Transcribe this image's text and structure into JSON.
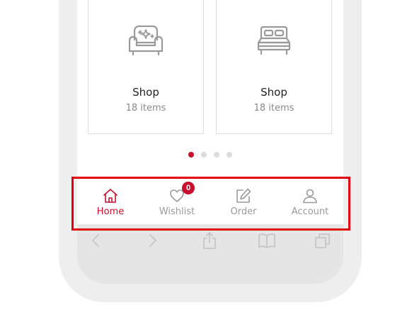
{
  "cards": [
    {
      "title": "Shop",
      "count": "18 items",
      "icon": "armchair-icon"
    },
    {
      "title": "Shop",
      "count": "18 items",
      "icon": "bed-icon"
    }
  ],
  "carousel": {
    "total_pages": 4,
    "active_page": 1
  },
  "nav": {
    "items": [
      {
        "label": "Home",
        "icon": "home-icon",
        "active": true
      },
      {
        "label": "Wishlist",
        "icon": "heart-icon",
        "badge": "0"
      },
      {
        "label": "Order",
        "icon": "edit-icon"
      },
      {
        "label": "Account",
        "icon": "user-icon"
      }
    ]
  },
  "browser_toolbar": {
    "items": [
      "back-icon",
      "forward-icon",
      "share-icon",
      "bookmarks-icon",
      "tabs-icon"
    ]
  },
  "colors": {
    "accent": "#c8102e",
    "highlight": "#e0000f",
    "muted_text": "#9a9a9a",
    "icon_gray": "#9a9a9a"
  }
}
